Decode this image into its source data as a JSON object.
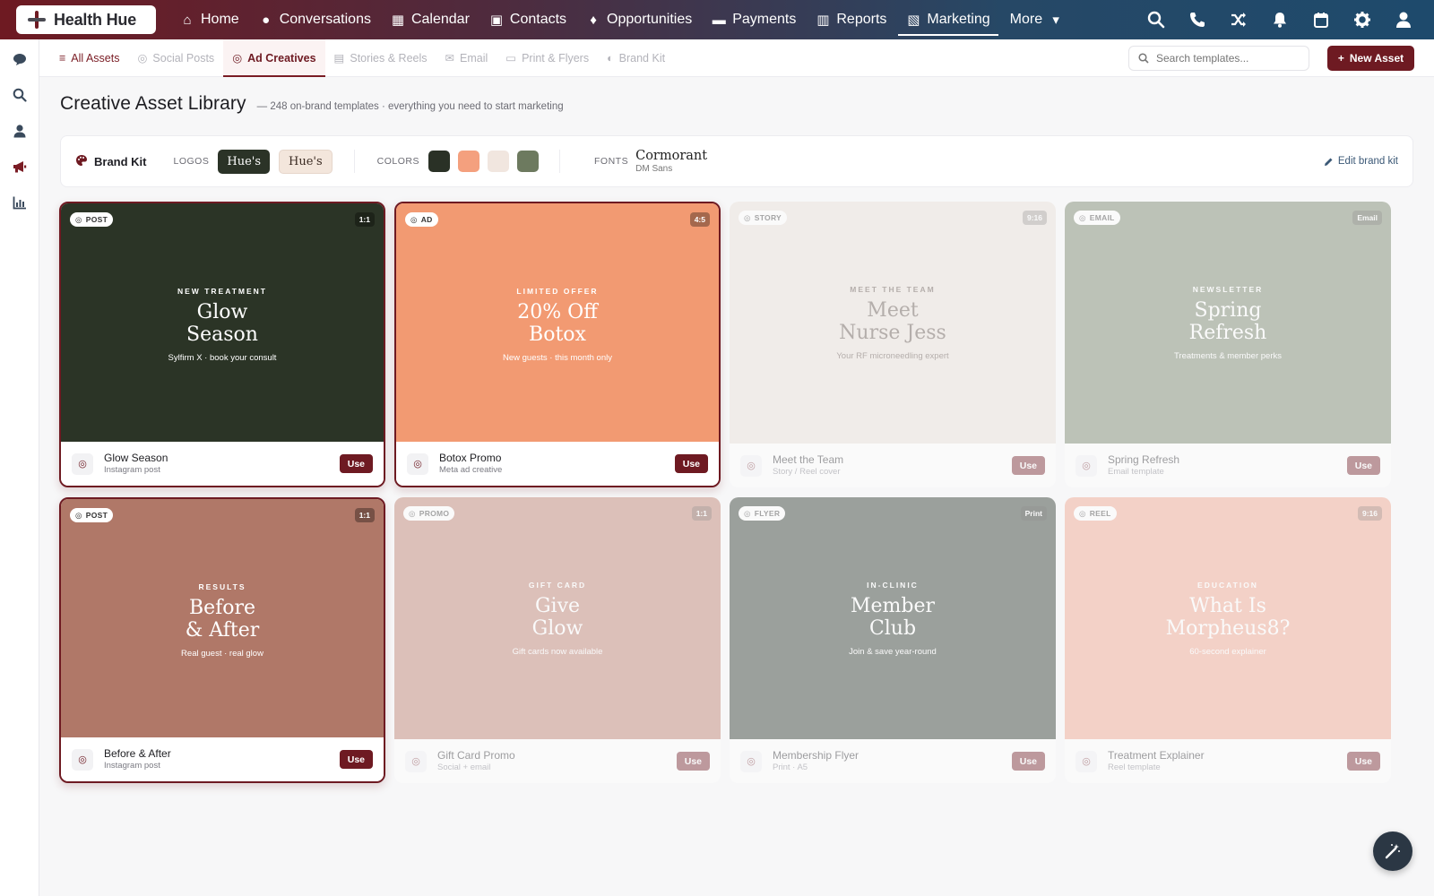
{
  "app": {
    "brand": "Health Hue"
  },
  "nav": [
    {
      "label": "Home",
      "icon": "⌂"
    },
    {
      "label": "Conversations",
      "icon": "●"
    },
    {
      "label": "Calendar",
      "icon": "▦"
    },
    {
      "label": "Contacts",
      "icon": "▣"
    },
    {
      "label": "Opportunities",
      "icon": "♦"
    },
    {
      "label": "Payments",
      "icon": "▬"
    },
    {
      "label": "Reports",
      "icon": "▥"
    },
    {
      "label": "Marketing",
      "icon": "▧"
    },
    {
      "label": "More",
      "icon": "▾"
    }
  ],
  "subtabs": [
    {
      "label": "All Assets",
      "icon": "≡"
    },
    {
      "label": "Social Posts",
      "icon": "◎"
    },
    {
      "label": "Ad Creatives",
      "icon": "◎"
    },
    {
      "label": "Stories & Reels",
      "icon": "▤"
    },
    {
      "label": "Email",
      "icon": "✉"
    },
    {
      "label": "Print & Flyers",
      "icon": "▭"
    },
    {
      "label": "Brand Kit",
      "icon": "◐"
    }
  ],
  "search": {
    "placeholder": "Search templates..."
  },
  "new_asset": {
    "label": "New Asset",
    "icon": "+"
  },
  "page": {
    "title": "Creative Asset Library",
    "subtitle": "— 248 on-brand templates · everything you need to start marketing"
  },
  "brand_kit": {
    "title": "Brand Kit",
    "logos_label": "LOGOS",
    "logo_dark": "Hue's",
    "logo_light": "Hue's",
    "colors_label": "COLORS",
    "colors": [
      "#2a3126",
      "#f4a07e",
      "#f1e6df",
      "#6d7a5f"
    ],
    "fonts_label": "FONTS",
    "font_primary": "Cormorant",
    "font_secondary": "DM Sans",
    "edit_label": "Edit brand kit"
  },
  "cards": [
    {
      "badge": "POST",
      "ratio": "1:1",
      "kicker": "NEW TREATMENT",
      "headline_1": "Glow",
      "headline_2": "Season",
      "tagline": "Sylfirm X · book your consult",
      "name": "Glow Season",
      "type": "Instagram post",
      "use": "Use",
      "bg": "#2b3426",
      "fg": "#ffffff",
      "selected": true,
      "dimmed": false
    },
    {
      "badge": "AD",
      "ratio": "4:5",
      "kicker": "LIMITED OFFER",
      "headline_1": "20% Off",
      "headline_2": "Botox",
      "tagline": "New guests · this month only",
      "name": "Botox Promo",
      "type": "Meta ad creative",
      "use": "Use",
      "bg": "#f29a72",
      "fg": "#ffffff",
      "selected": true,
      "dimmed": false
    },
    {
      "badge": "STORY",
      "ratio": "9:16",
      "kicker": "MEET THE TEAM",
      "headline_1": "Meet",
      "headline_2": "Nurse Jess",
      "tagline": "Your RF microneedling expert",
      "name": "Meet the Team",
      "type": "Story / Reel cover",
      "use": "Use",
      "bg": "#e8ded6",
      "fg": "#5a4a42",
      "selected": false,
      "dimmed": true
    },
    {
      "badge": "EMAIL",
      "ratio": "Email",
      "kicker": "NEWSLETTER",
      "headline_1": "Spring",
      "headline_2": "Refresh",
      "tagline": "Treatments & member perks",
      "name": "Spring Refresh",
      "type": "Email template",
      "use": "Use",
      "bg": "#6d7a5f",
      "fg": "#ffffff",
      "selected": false,
      "dimmed": true
    },
    {
      "badge": "POST",
      "ratio": "1:1",
      "kicker": "RESULTS",
      "headline_1": "Before",
      "headline_2": "& After",
      "tagline": "Real guest · real glow",
      "name": "Before & After",
      "type": "Instagram post",
      "use": "Use",
      "bg": "#b07868",
      "fg": "#ffffff",
      "selected": true,
      "dimmed": false
    },
    {
      "badge": "PROMO",
      "ratio": "1:1",
      "kicker": "GIFT CARD",
      "headline_1": "Give",
      "headline_2": "Glow",
      "tagline": "Gift cards now available",
      "name": "Gift Card Promo",
      "type": "Social + email",
      "use": "Use",
      "bg": "#b87664",
      "fg": "#ffffff",
      "selected": false,
      "dimmed": true
    },
    {
      "badge": "FLYER",
      "ratio": "Print",
      "kicker": "IN-CLINIC",
      "headline_1": "Member",
      "headline_2": "Club",
      "tagline": "Join & save year-round",
      "name": "Membership Flyer",
      "type": "Print · A5",
      "use": "Use",
      "bg": "#1f2a1e",
      "fg": "#ffffff",
      "selected": false,
      "dimmed": true
    },
    {
      "badge": "REEL",
      "ratio": "9:16",
      "kicker": "EDUCATION",
      "headline_1": "What Is",
      "headline_2": "Morpheus8?",
      "tagline": "60-second explainer",
      "name": "Treatment Explainer",
      "type": "Reel template",
      "use": "Use",
      "bg": "#ef9e84",
      "fg": "#ffffff",
      "selected": false,
      "dimmed": true
    }
  ]
}
